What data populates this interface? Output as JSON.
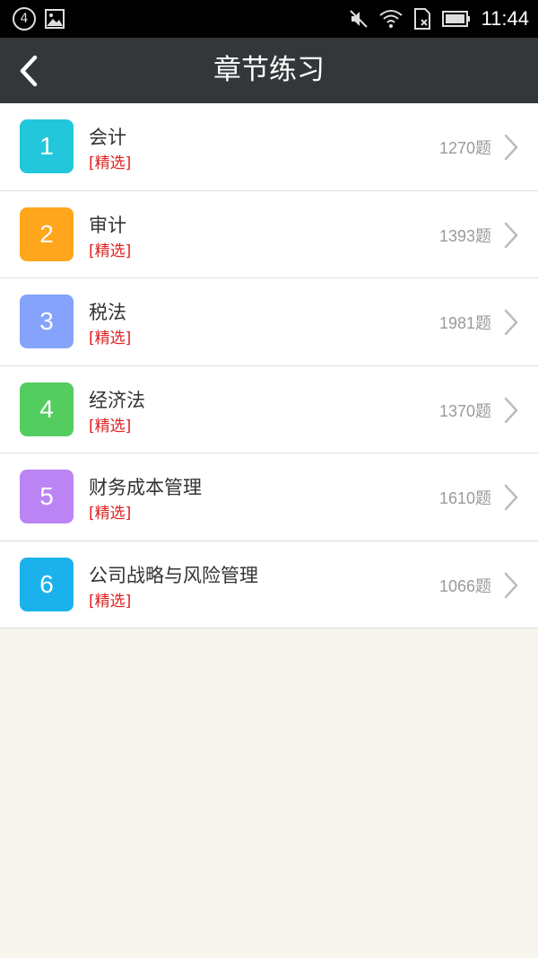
{
  "status_bar": {
    "badge": "4",
    "time": "11:44",
    "icons": [
      "notification-badge-icon",
      "image-icon",
      "mute-icon",
      "wifi-icon",
      "sim-icon",
      "battery-icon"
    ]
  },
  "nav": {
    "title": "章节练习",
    "back_icon": "chevron-left-icon",
    "bg_color": "#33373a"
  },
  "items": [
    {
      "number": "1",
      "title": "会计",
      "tag": "[精选]",
      "count": "1270题",
      "color": "#23c7dc"
    },
    {
      "number": "2",
      "title": "审计",
      "tag": "[精选]",
      "count": "1393题",
      "color": "#ffa61c"
    },
    {
      "number": "3",
      "title": "税法",
      "tag": "[精选]",
      "count": "1981题",
      "color": "#85a3fb"
    },
    {
      "number": "4",
      "title": "经济法",
      "tag": "[精选]",
      "count": "1370题",
      "color": "#53cd5f"
    },
    {
      "number": "5",
      "title": "财务成本管理",
      "tag": "[精选]",
      "count": "1610题",
      "color": "#bb84f5"
    },
    {
      "number": "6",
      "title": "公司战略与风险管理",
      "tag": "[精选]",
      "count": "1066题",
      "color": "#1bb2ec"
    }
  ]
}
